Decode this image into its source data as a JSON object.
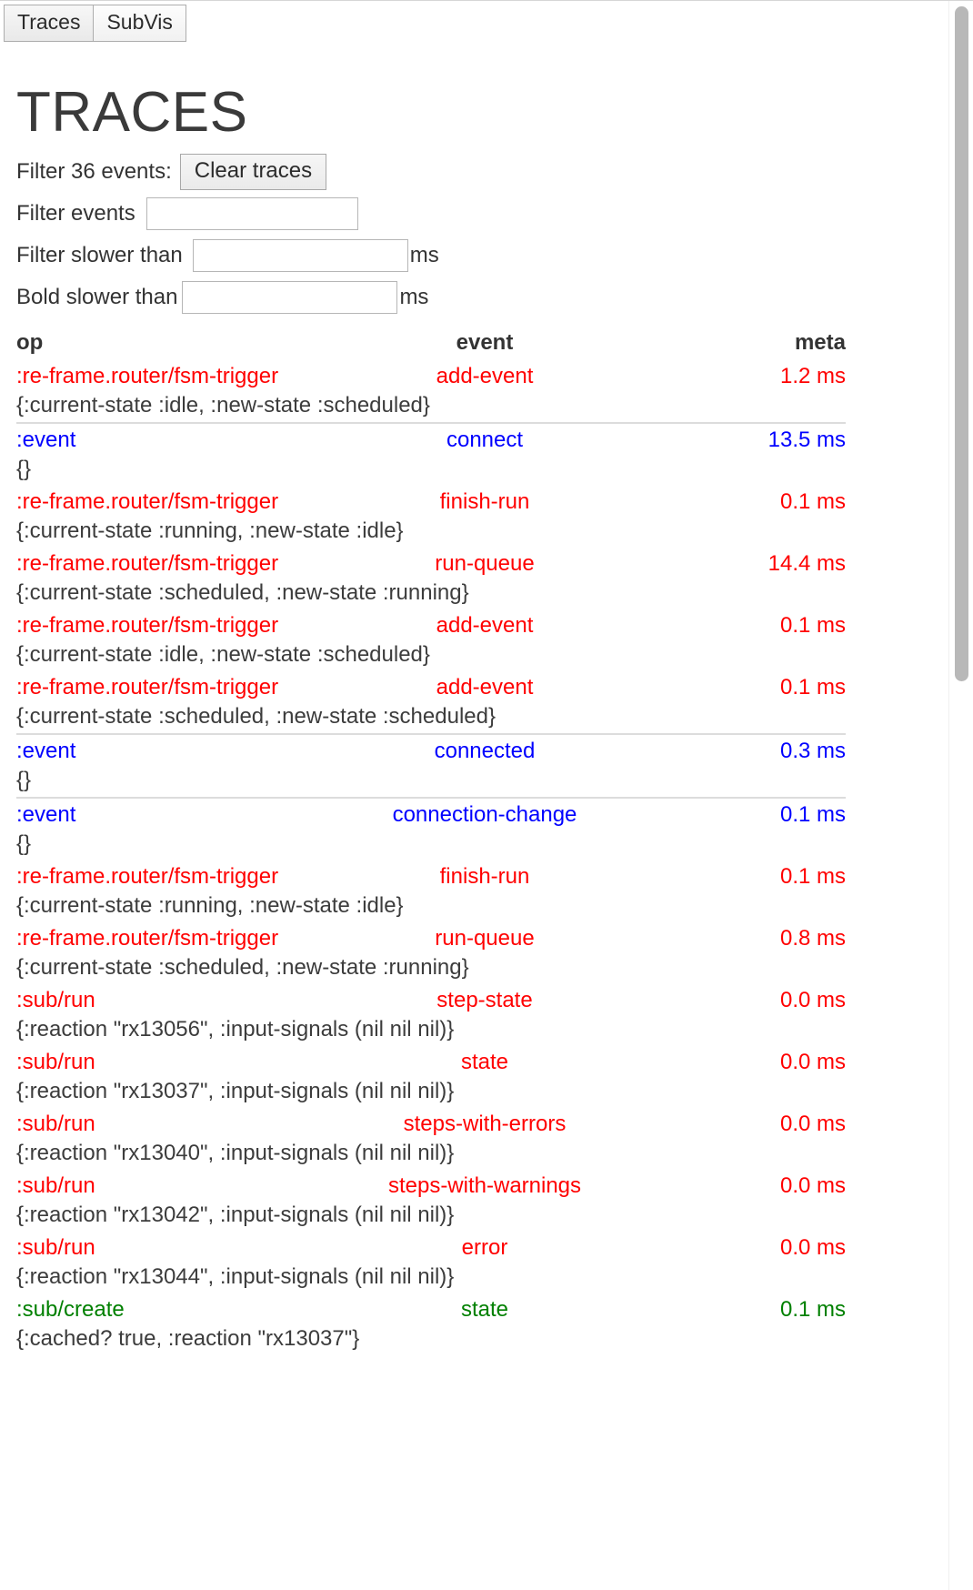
{
  "tabs": [
    {
      "label": "Traces",
      "active": true
    },
    {
      "label": "SubVis",
      "active": false
    }
  ],
  "page": {
    "title": "TRACES"
  },
  "filters": {
    "count_label": "Filter 36 events:",
    "clear_button": "Clear traces",
    "events_label": "Filter events",
    "events_value": "",
    "slower_label": "Filter slower than",
    "slower_value": "",
    "slower_unit": "ms",
    "bold_label": "Bold slower than",
    "bold_value": "",
    "bold_unit": "ms"
  },
  "table": {
    "headers": {
      "op": "op",
      "event": "event",
      "meta": "meta"
    },
    "rows": [
      {
        "op": ":re-frame.router/fsm-trigger",
        "event": "add-event",
        "meta": "1.2 ms",
        "detail": "{:current-state :idle, :new-state :scheduled}",
        "color": "red",
        "separator": false
      },
      {
        "op": ":event",
        "event": "connect",
        "meta": "13.5 ms",
        "detail": "{}",
        "color": "blue",
        "separator": true
      },
      {
        "op": ":re-frame.router/fsm-trigger",
        "event": "finish-run",
        "meta": "0.1 ms",
        "detail": "{:current-state :running, :new-state :idle}",
        "color": "red",
        "separator": false
      },
      {
        "op": ":re-frame.router/fsm-trigger",
        "event": "run-queue",
        "meta": "14.4 ms",
        "detail": "{:current-state :scheduled, :new-state :running}",
        "color": "red",
        "separator": false
      },
      {
        "op": ":re-frame.router/fsm-trigger",
        "event": "add-event",
        "meta": "0.1 ms",
        "detail": "{:current-state :idle, :new-state :scheduled}",
        "color": "red",
        "separator": false
      },
      {
        "op": ":re-frame.router/fsm-trigger",
        "event": "add-event",
        "meta": "0.1 ms",
        "detail": "{:current-state :scheduled, :new-state :scheduled}",
        "color": "red",
        "separator": false
      },
      {
        "op": ":event",
        "event": "connected",
        "meta": "0.3 ms",
        "detail": "{}",
        "color": "blue",
        "separator": true
      },
      {
        "op": ":event",
        "event": "connection-change",
        "meta": "0.1 ms",
        "detail": "{}",
        "color": "blue",
        "separator": true
      },
      {
        "op": ":re-frame.router/fsm-trigger",
        "event": "finish-run",
        "meta": "0.1 ms",
        "detail": "{:current-state :running, :new-state :idle}",
        "color": "red",
        "separator": false
      },
      {
        "op": ":re-frame.router/fsm-trigger",
        "event": "run-queue",
        "meta": "0.8 ms",
        "detail": "{:current-state :scheduled, :new-state :running}",
        "color": "red",
        "separator": false
      },
      {
        "op": ":sub/run",
        "event": "step-state",
        "meta": "0.0 ms",
        "detail": "{:reaction \"rx13056\", :input-signals (nil nil nil)}",
        "color": "red",
        "separator": false
      },
      {
        "op": ":sub/run",
        "event": "state",
        "meta": "0.0 ms",
        "detail": "{:reaction \"rx13037\", :input-signals (nil nil nil)}",
        "color": "red",
        "separator": false
      },
      {
        "op": ":sub/run",
        "event": "steps-with-errors",
        "meta": "0.0 ms",
        "detail": "{:reaction \"rx13040\", :input-signals (nil nil nil)}",
        "color": "red",
        "separator": false
      },
      {
        "op": ":sub/run",
        "event": "steps-with-warnings",
        "meta": "0.0 ms",
        "detail": "{:reaction \"rx13042\", :input-signals (nil nil nil)}",
        "color": "red",
        "separator": false
      },
      {
        "op": ":sub/run",
        "event": "error",
        "meta": "0.0 ms",
        "detail": "{:reaction \"rx13044\", :input-signals (nil nil nil)}",
        "color": "red",
        "separator": false
      },
      {
        "op": ":sub/create",
        "event": "state",
        "meta": "0.1 ms",
        "detail": "{:cached? true, :reaction \"rx13037\"}",
        "color": "green",
        "separator": false
      }
    ]
  },
  "colors": {
    "red": "#ff0000",
    "blue": "#0000ff",
    "green": "#008000",
    "text": "#333333",
    "separator": "#dcdcdc",
    "scrollbar_thumb": "#b8b8b8"
  }
}
